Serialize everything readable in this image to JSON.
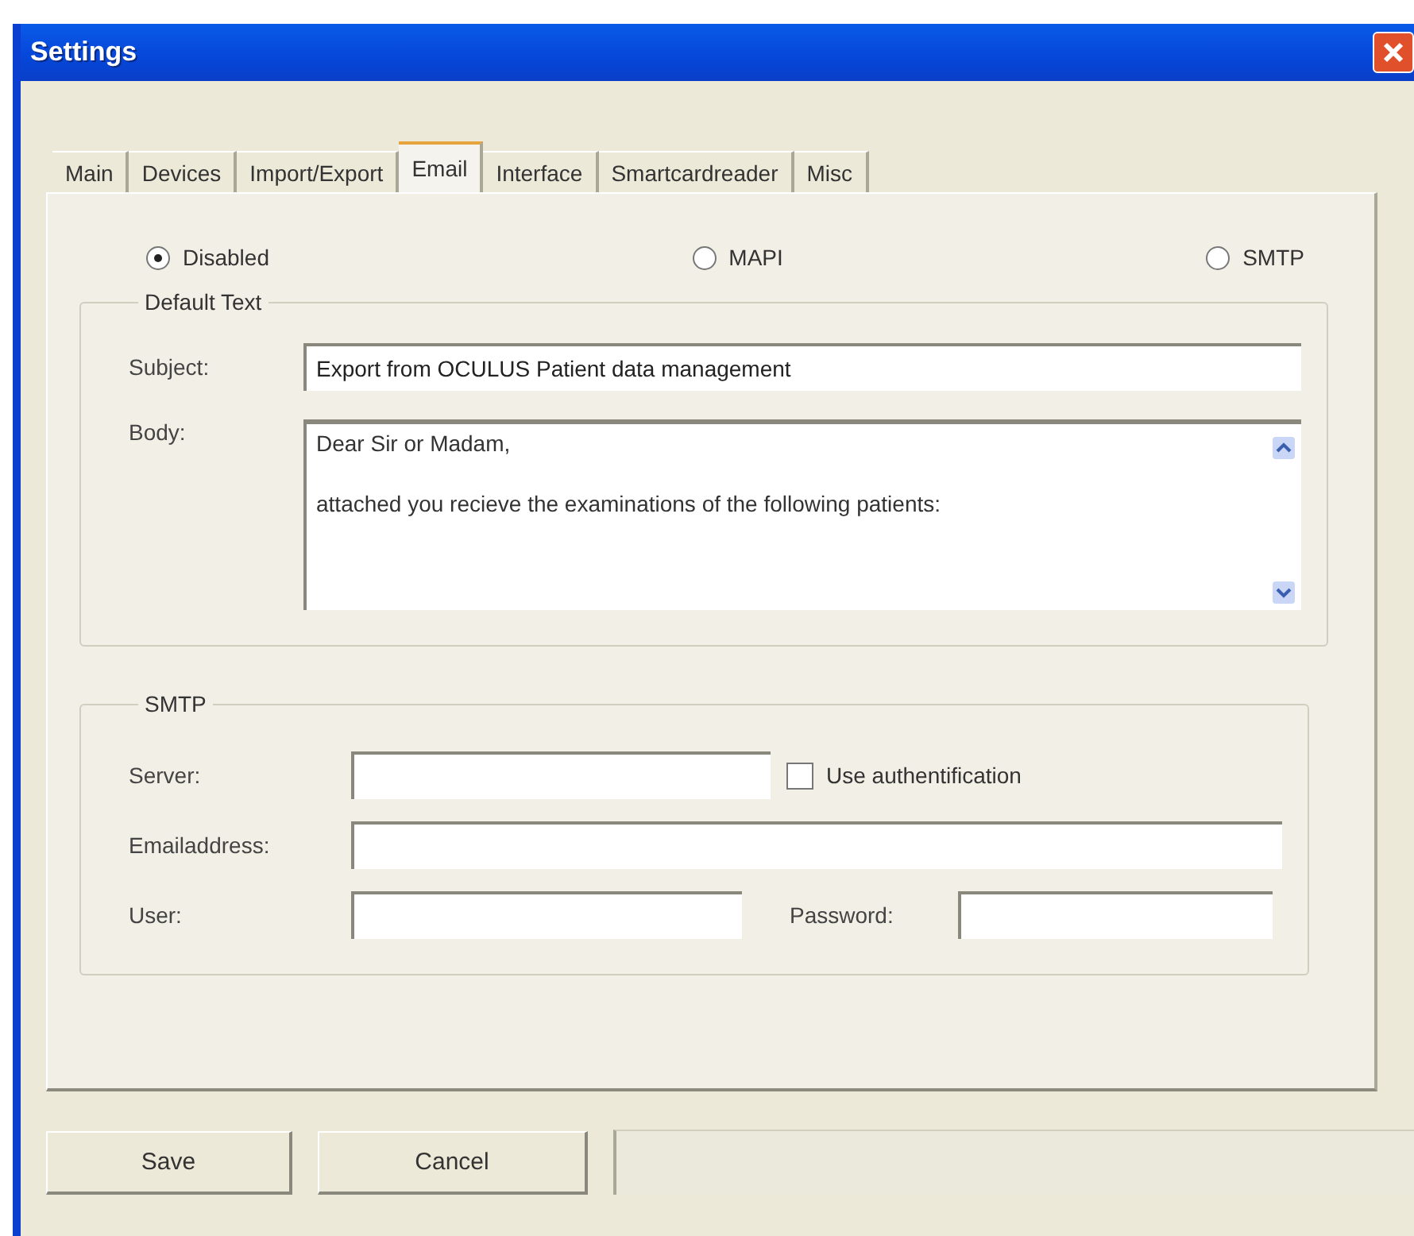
{
  "window": {
    "title": "Settings"
  },
  "tabs": [
    {
      "label": "Main",
      "selected": false
    },
    {
      "label": "Devices",
      "selected": false
    },
    {
      "label": "Import/Export",
      "selected": false
    },
    {
      "label": "Email",
      "selected": true
    },
    {
      "label": "Interface",
      "selected": false
    },
    {
      "label": "Smartcardreader",
      "selected": false
    },
    {
      "label": "Misc",
      "selected": false
    }
  ],
  "mode_options": [
    {
      "label": "Disabled",
      "selected": true
    },
    {
      "label": "MAPI",
      "selected": false
    },
    {
      "label": "SMTP",
      "selected": false
    }
  ],
  "default_text": {
    "title": "Default Text",
    "subject_label": "Subject:",
    "subject_value": "Export from OCULUS Patient data management",
    "body_label": "Body:",
    "body_lines": [
      "Dear Sir or Madam,",
      "attached you recieve the examinations of the following patients:"
    ]
  },
  "smtp": {
    "title": "SMTP",
    "server_label": "Server:",
    "use_authentification": {
      "label": "Use authentification",
      "checked": false
    },
    "email_label": "Emailaddress:",
    "user_label": "User:",
    "password_label": "Password:"
  },
  "buttons": [
    "Save",
    "Cancel"
  ]
}
